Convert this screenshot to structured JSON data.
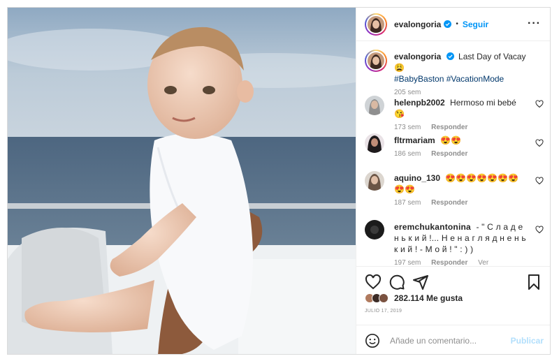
{
  "post": {
    "author": "evalongoria",
    "follow_label": "Seguir",
    "more_icon": "more-options-icon",
    "dot": "•"
  },
  "caption": {
    "user": "evalongoria",
    "text": "Last Day of Vacay",
    "emoji": "😩",
    "hashtags": "#BabyBaston #VacationMode",
    "time": "205 sem"
  },
  "comments": [
    {
      "user": "helenpb2002",
      "text": "Hermoso mi bebé",
      "emoji": "😘",
      "time": "173 sem",
      "reply": "Responder"
    },
    {
      "user": "fltrmariam",
      "text": "",
      "emoji": "😍😍",
      "time": "186 sem",
      "reply": "Responder"
    },
    {
      "user": "aquino_130",
      "text": "",
      "emoji": "😍😍😍😍😍😍😍😍😍",
      "time": "187 sem",
      "reply": "Responder"
    },
    {
      "user": "eremchukantonina",
      "text": "- \" С л а д е н ь к и й !... Н е н а г л я д н е н ь к и й ! - М о й ! \" : ) )",
      "emoji": "",
      "time": "197 sem",
      "reply": "Responder",
      "translate": "Ver traducción"
    }
  ],
  "likes": {
    "count_label": "282.114 Me gusta",
    "date": "JULIO 17, 2019"
  },
  "add_comment": {
    "placeholder": "Añade un comentario...",
    "publish_label": "Publicar"
  },
  "colors": {
    "accent": "#0095f6",
    "hashtag": "#00376b",
    "muted": "#8e8e8e",
    "publish_disabled": "#b2dffc"
  }
}
